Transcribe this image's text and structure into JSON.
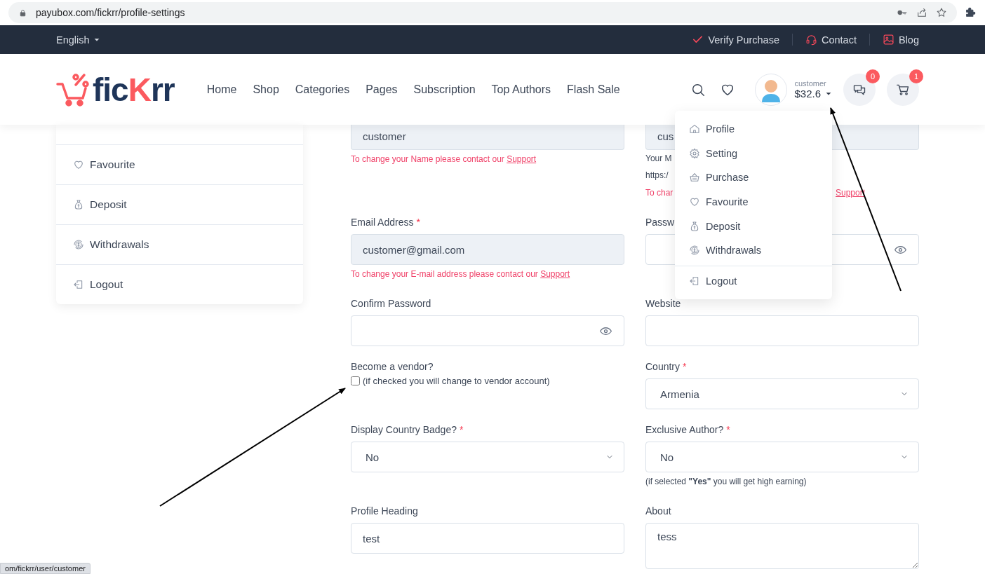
{
  "browser": {
    "url": "payubox.com/fickrr/profile-settings"
  },
  "topbar": {
    "language": "English",
    "links": [
      {
        "label": "Verify Purchase"
      },
      {
        "label": "Contact"
      },
      {
        "label": "Blog"
      }
    ]
  },
  "header": {
    "logo": [
      {
        "text": "fic",
        "accent": false
      },
      {
        "text": "K",
        "accent": true
      },
      {
        "text": "rr",
        "accent": false
      }
    ],
    "nav": [
      {
        "label": "Home"
      },
      {
        "label": "Shop"
      },
      {
        "label": "Categories"
      },
      {
        "label": "Pages"
      },
      {
        "label": "Subscription"
      },
      {
        "label": "Top Authors"
      },
      {
        "label": "Flash Sale"
      }
    ],
    "user": {
      "name": "customer",
      "balance": "$32.6"
    },
    "messages_badge": "0",
    "cart_badge": "1"
  },
  "user_menu": {
    "items": [
      {
        "label": "Profile",
        "divider_before": false
      },
      {
        "label": "Setting",
        "divider_before": false
      },
      {
        "label": "Purchase",
        "divider_before": false
      },
      {
        "label": "Favourite",
        "divider_before": false
      },
      {
        "label": "Deposit",
        "divider_before": false
      },
      {
        "label": "Withdrawals",
        "divider_before": false
      },
      {
        "label": "Logout",
        "divider_before": true
      }
    ]
  },
  "sidebar": {
    "items": [
      {
        "label": "Favourite"
      },
      {
        "label": "Deposit"
      },
      {
        "label": "Withdrawals"
      },
      {
        "label": "Logout"
      }
    ]
  },
  "form": {
    "rows": [
      {
        "left": {
          "kind": "input",
          "value": "customer",
          "readonly": true,
          "hints": [
            {
              "kind": "warning",
              "text": "To change your Name please contact our",
              "link": "Support"
            }
          ]
        },
        "right": {
          "kind": "input",
          "value": "cus",
          "readonly": true,
          "hints": [
            {
              "kind": "note",
              "text": "Your M"
            },
            {
              "kind": "note",
              "text": "https:/"
            },
            {
              "kind": "split_warning",
              "text": "To char",
              "link": "Support"
            }
          ]
        }
      },
      {
        "left": {
          "kind": "input",
          "label": "Email Address",
          "mark": "*",
          "value": "customer@gmail.com",
          "readonly": true,
          "hints": [
            {
              "kind": "warning",
              "text": "To change your E-mail address please contact our",
              "link": "Support"
            }
          ]
        },
        "right": {
          "kind": "password",
          "label": "Passw",
          "readonly": false
        }
      },
      {
        "left": {
          "kind": "password",
          "label": "Confirm Password",
          "readonly": false
        },
        "right": {
          "kind": "input",
          "label": "Website",
          "readonly": false
        }
      },
      {
        "left": {
          "kind": "checkbox",
          "label": "Become a vendor?",
          "checked": false,
          "text": "(if checked you will change to vendor account)"
        },
        "right": {
          "kind": "select",
          "label": "Country",
          "mark": "*",
          "value": "Armenia"
        }
      },
      {
        "left": {
          "kind": "select",
          "label": "Display Country Badge?",
          "mark": "*",
          "value": "No"
        },
        "right": {
          "kind": "select",
          "label": "Exclusive Author?",
          "mark": "*",
          "value": "No",
          "hints": [
            {
              "kind": "plain",
              "text": "(if selected **\"Yes\"** you will get high earning)"
            }
          ]
        }
      },
      {
        "left": {
          "kind": "input",
          "label": "Profile Heading",
          "value": "test",
          "readonly": false
        },
        "right": {
          "kind": "textarea",
          "label": "About",
          "value": "tess"
        }
      }
    ]
  },
  "status_bar": "om/fickrr/user/customer"
}
